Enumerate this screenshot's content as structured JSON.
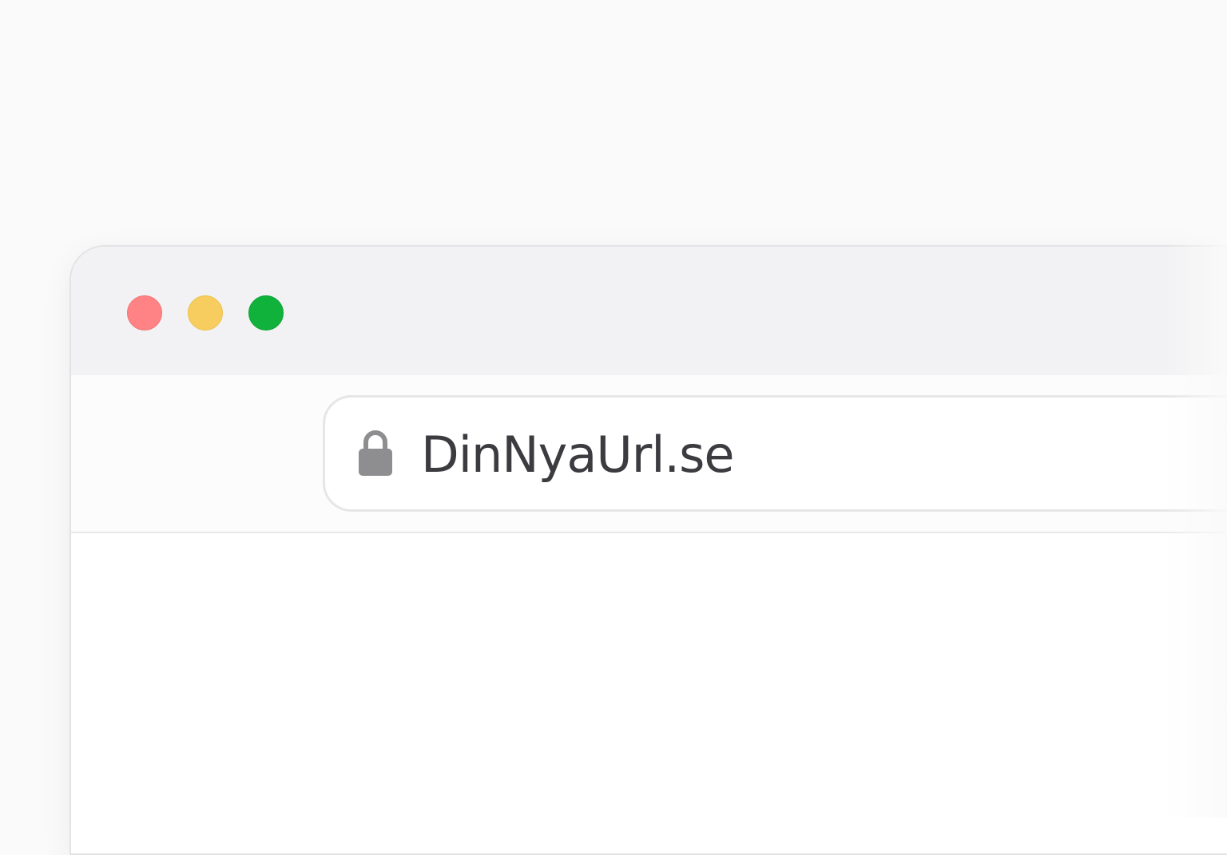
{
  "browser": {
    "window_controls": {
      "close": {
        "icon": "close-traffic-light-icon",
        "color": "#ff8385"
      },
      "minimize": {
        "icon": "minimize-traffic-light-icon",
        "color": "#f6cd5e"
      },
      "zoom": {
        "icon": "zoom-traffic-light-icon",
        "color": "#10b23c"
      }
    },
    "address_bar": {
      "icon": "lock-icon",
      "url": "DinNyaUrl.se"
    }
  }
}
